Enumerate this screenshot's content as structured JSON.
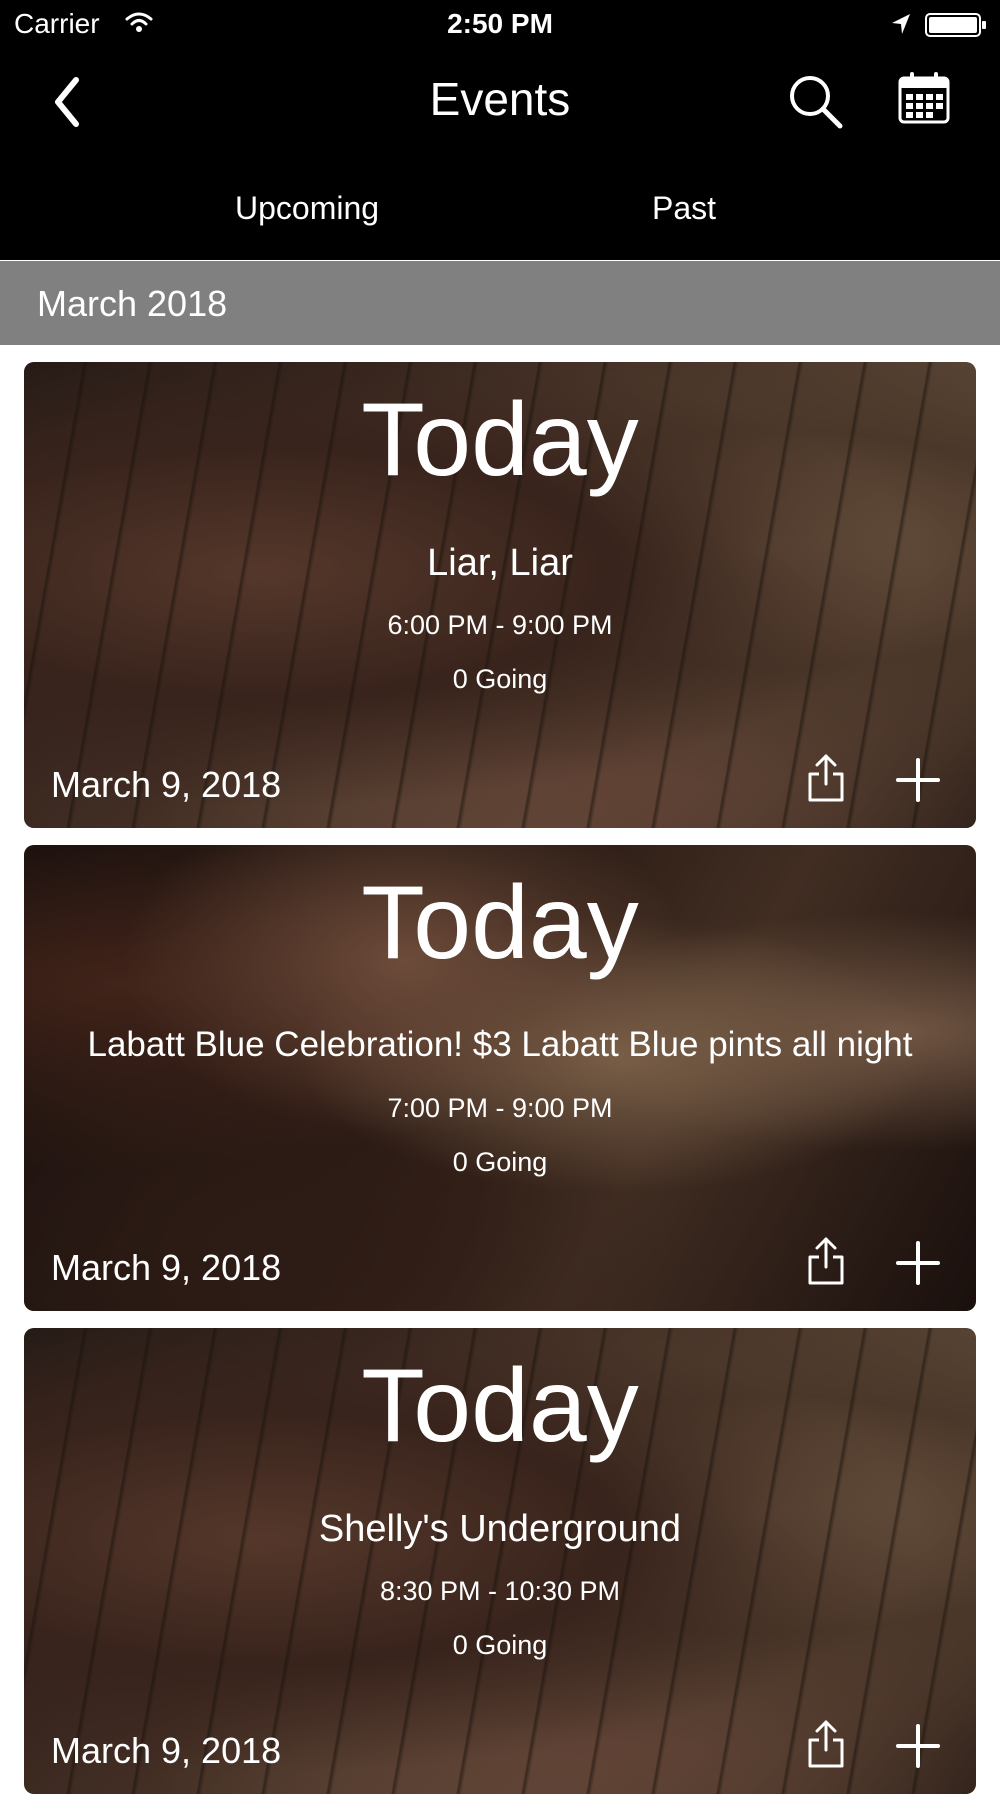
{
  "status_bar": {
    "carrier": "Carrier",
    "time": "2:50 PM",
    "icons": [
      "wifi-icon",
      "location-arrow-icon",
      "battery-icon"
    ]
  },
  "nav": {
    "title": "Events",
    "icons": [
      "chevron-left-icon",
      "search-icon",
      "calendar-icon"
    ]
  },
  "tabs": [
    {
      "label": "Upcoming"
    },
    {
      "label": "Past"
    }
  ],
  "section": {
    "title": "March 2018"
  },
  "events": [
    {
      "day": "Today",
      "title": "Liar, Liar",
      "time": "6:00 PM - 9:00 PM",
      "going": "0 Going",
      "date": "March 9, 2018",
      "image": "guitar-photo"
    },
    {
      "day": "Today",
      "title": "Labatt Blue Celebration! $3 Labatt Blue pints all night",
      "time": "7:00 PM - 9:00 PM",
      "going": "0 Going",
      "date": "March 9, 2018",
      "image": "party-photo"
    },
    {
      "day": "Today",
      "title": "Shelly's Underground",
      "time": "8:30 PM - 10:30 PM",
      "going": "0 Going",
      "date": "March 9, 2018",
      "image": "guitar-photo"
    }
  ],
  "colors": {
    "header_bg": "#000000",
    "section_bg": "#808080",
    "text": "#ffffff"
  }
}
